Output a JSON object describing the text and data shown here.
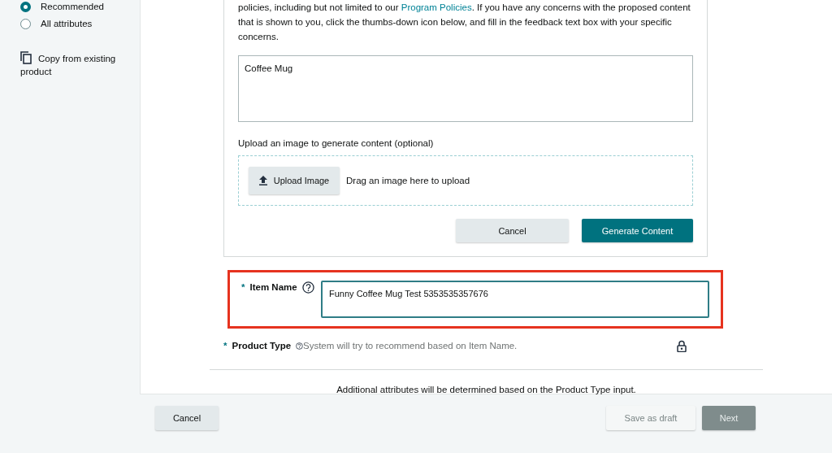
{
  "sidebar": {
    "attribute_view": [
      {
        "label": "Recommended",
        "selected": true
      },
      {
        "label": "All attributes",
        "selected": false
      }
    ],
    "copy_link": "Copy from existing product"
  },
  "generator": {
    "notice": {
      "before": "policies, including but not limited to our",
      "link": "Program Policies",
      "after": ". If you have any concerns with the proposed content that is shown to you, click the thumbs-down icon below, and fill in the feedback text box with your specific concerns."
    },
    "description_value": "Coffee Mug",
    "upload_label": "Upload an image to generate content (optional)",
    "upload_button": "Upload Image",
    "drop_hint": "Drag an image here to upload",
    "buttons": [
      {
        "label": "Cancel",
        "kind": "secondary"
      },
      {
        "label": "Generate Content",
        "kind": "primary"
      }
    ]
  },
  "fields": [
    {
      "label": "Item Name",
      "required_mark": "*",
      "kind": "input",
      "value": "Funny Coffee Mug Test 5353535357676",
      "highlighted": true
    },
    {
      "label": "Product Type",
      "required_mark": "*",
      "kind": "locked",
      "placeholder": "System will try to recommend based on Item Name.",
      "highlighted": false
    }
  ],
  "additional_note": "Additional attributes will be determined based on the Product Type input.",
  "footer": {
    "cancel": {
      "label": "Cancel",
      "disabled": false
    },
    "actions": [
      {
        "label": "Save as draft",
        "kind": "secondary",
        "disabled": true
      },
      {
        "label": "Next",
        "kind": "primary",
        "disabled": true
      }
    ]
  }
}
